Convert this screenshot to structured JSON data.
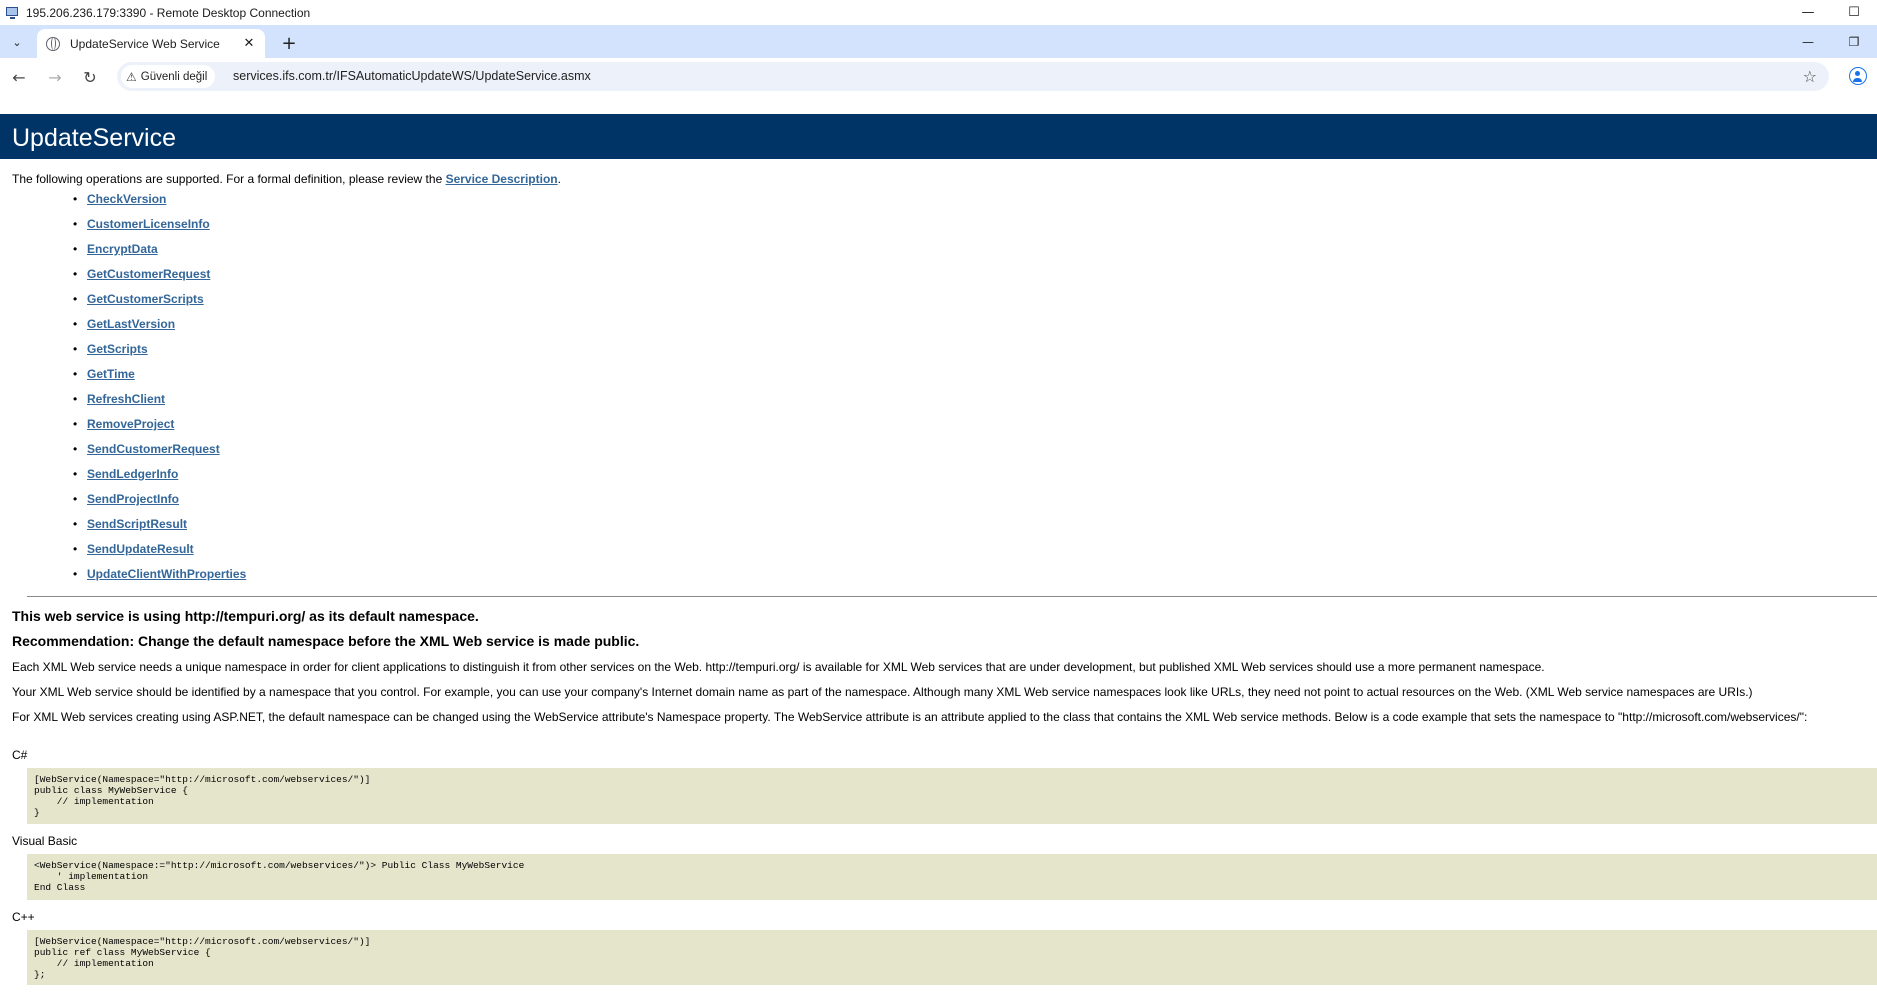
{
  "rdp": {
    "title": "195.206.236.179:3390 - Remote Desktop Connection",
    "minimize_icon": "—",
    "maximize_icon": "☐"
  },
  "browser": {
    "tab_search_icon": "⌄",
    "tab_title": "UpdateService Web Service",
    "tab_close": "✕",
    "new_tab": "+",
    "window_minimize": "—",
    "window_restore": "❐",
    "nav_back": "←",
    "nav_forward": "→",
    "nav_reload": "↻",
    "security_chip": "Güvenli değil",
    "warning_icon": "⚠",
    "url": "services.ifs.com.tr/IFSAutomaticUpdateWS/UpdateService.asmx",
    "bookmark_icon": "☆"
  },
  "page": {
    "heading": "UpdateService",
    "intro_before": "The following operations are supported. For a formal definition, please review the ",
    "intro_link": "Service Description",
    "intro_after": ".",
    "operations": [
      "CheckVersion",
      "CustomerLicenseInfo",
      "EncryptData",
      "GetCustomerRequest",
      "GetCustomerScripts",
      "GetLastVersion",
      "GetScripts",
      "GetTime",
      "RefreshClient",
      "RemoveProject",
      "SendCustomerRequest",
      "SendLedgerInfo",
      "SendProjectInfo",
      "SendScriptResult",
      "SendUpdateResult",
      "UpdateClientWithProperties"
    ],
    "namespace_line": "This web service is using http://tempuri.org/ as its default namespace.",
    "recommendation_line": "Recommendation: Change the default namespace before the XML Web service is made public.",
    "para1": "Each XML Web service needs a unique namespace in order for client applications to distinguish it from other services on the Web. http://tempuri.org/ is available for XML Web services that are under development, but published XML Web services should use a more permanent namespace.",
    "para2": "Your XML Web service should be identified by a namespace that you control. For example, you can use your company's Internet domain name as part of the namespace. Although many XML Web service namespaces look like URLs, they need not point to actual resources on the Web. (XML Web service namespaces are URIs.)",
    "para3": "For XML Web services creating using ASP.NET, the default namespace can be changed using the WebService attribute's Namespace property. The WebService attribute is an attribute applied to the class that contains the XML Web service methods. Below is a code example that sets the namespace to \"http://microsoft.com/webservices/\":",
    "code_samples": [
      {
        "language": "C#",
        "lines": [
          "[WebService(Namespace=\"http://microsoft.com/webservices/\")]",
          "public class MyWebService {",
          "    // implementation",
          "}"
        ]
      },
      {
        "language": "Visual Basic",
        "lines": [
          "<WebService(Namespace:=\"http://microsoft.com/webservices/\")> Public Class MyWebService",
          "    ' implementation",
          "End Class"
        ]
      },
      {
        "language": "C++",
        "lines": [
          "[WebService(Namespace=\"http://microsoft.com/webservices/\")]",
          "public ref class MyWebService {",
          "    // implementation",
          "};"
        ]
      }
    ]
  },
  "colors": {
    "header_bg": "#003366",
    "link": "#336699",
    "code_bg": "#e5e5cc",
    "tab_strip": "#d3e3fd"
  }
}
